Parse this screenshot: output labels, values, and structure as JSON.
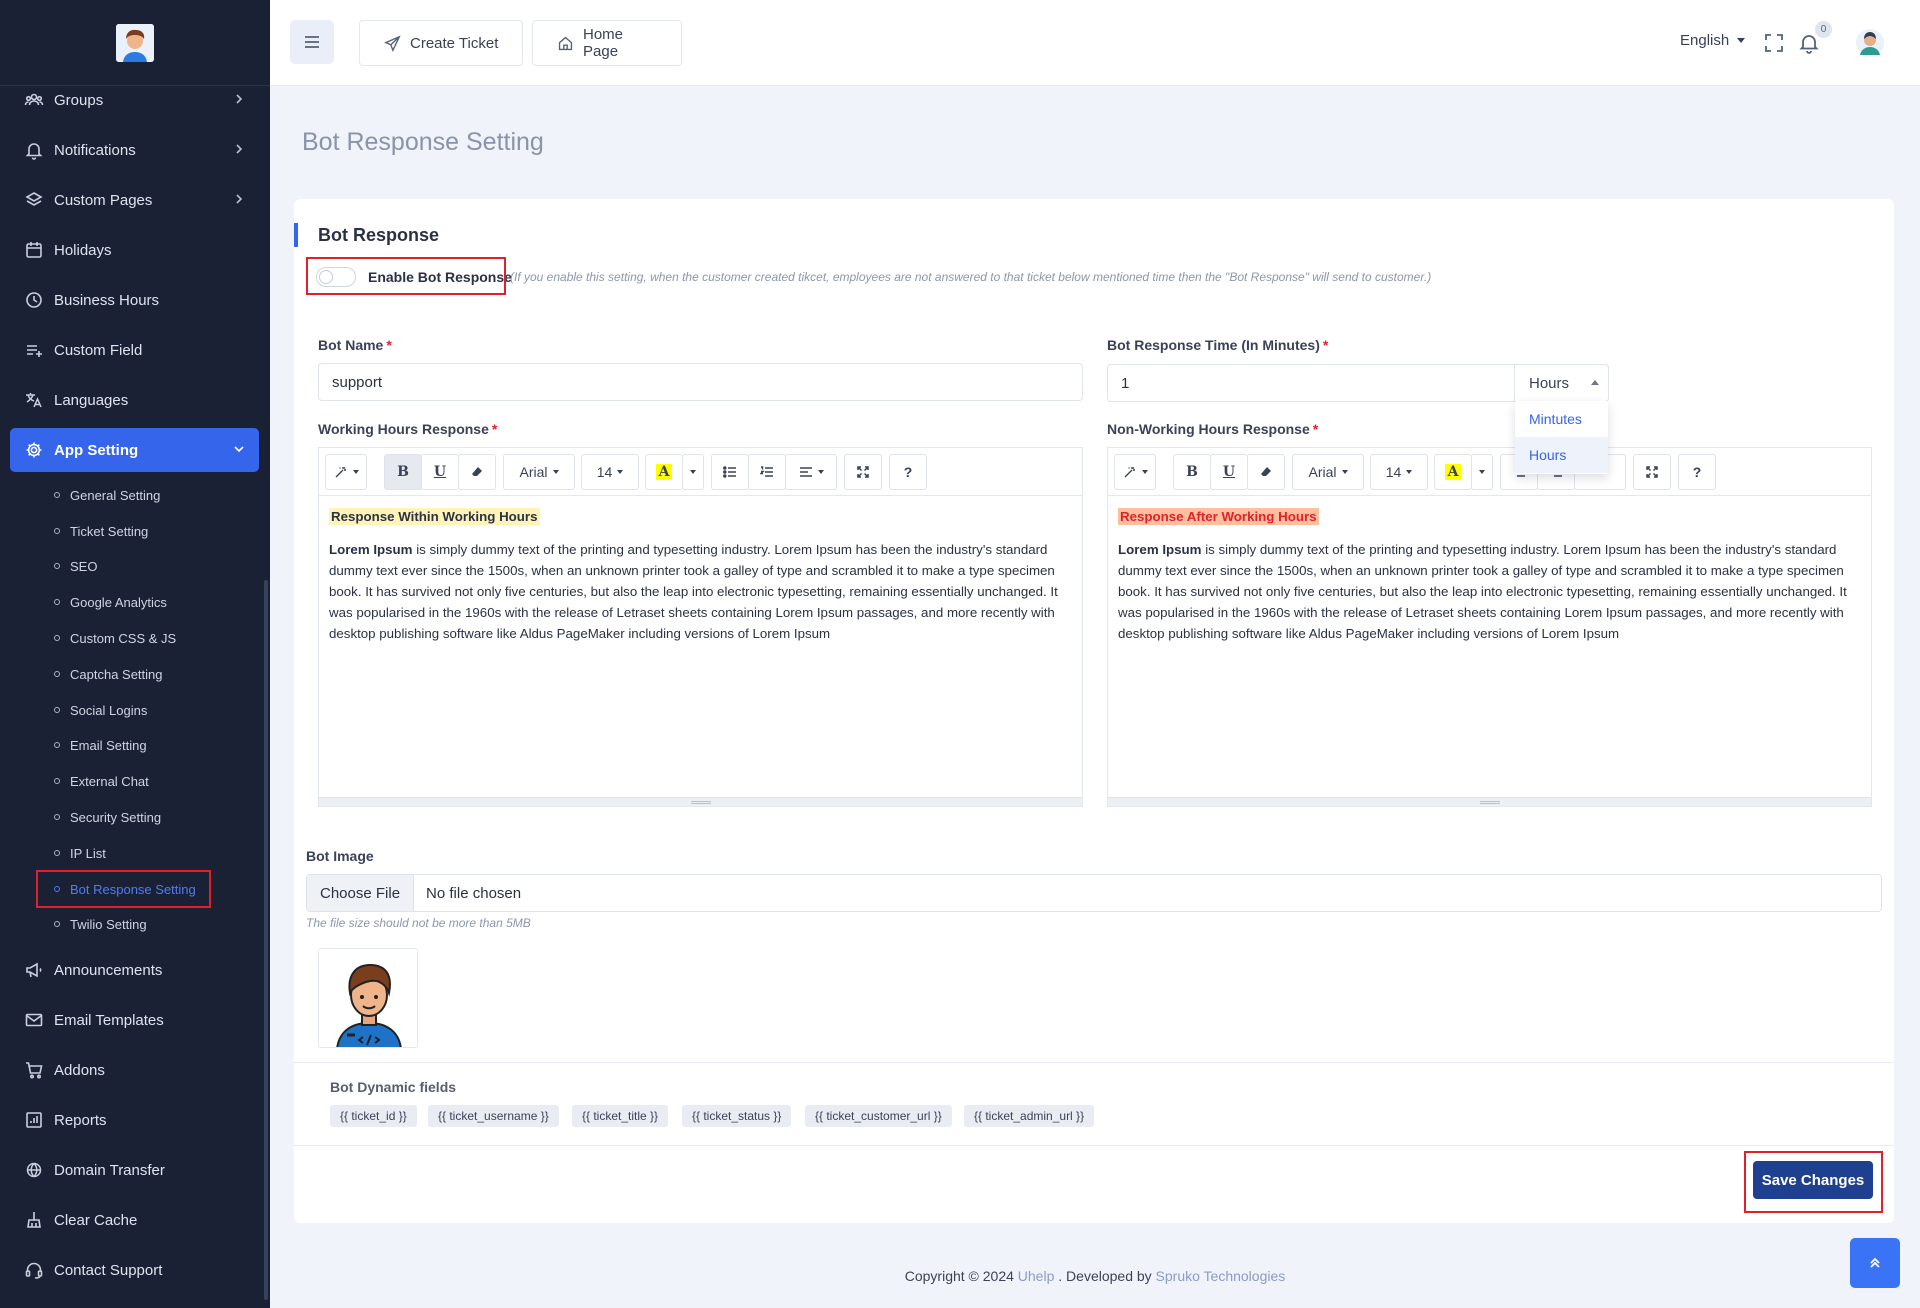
{
  "sidebar": {
    "menu": [
      {
        "label": "Groups",
        "icon": "groups-icon"
      },
      {
        "label": "Notifications",
        "icon": "bell-icon"
      },
      {
        "label": "Custom Pages",
        "icon": "layers-icon"
      },
      {
        "label": "Holidays",
        "icon": "calendar-icon"
      },
      {
        "label": "Business Hours",
        "icon": "clock-icon"
      },
      {
        "label": "Custom Field",
        "icon": "list-plus-icon"
      },
      {
        "label": "Languages",
        "icon": "translate-icon"
      },
      {
        "label": "App Setting",
        "icon": "gear-icon"
      },
      {
        "label": "Announcements",
        "icon": "megaphone-icon"
      },
      {
        "label": "Email Templates",
        "icon": "mail-icon"
      },
      {
        "label": "Addons",
        "icon": "cart-icon"
      },
      {
        "label": "Reports",
        "icon": "report-icon"
      },
      {
        "label": "Domain Transfer",
        "icon": "globe-icon"
      },
      {
        "label": "Clear Cache",
        "icon": "broom-icon"
      },
      {
        "label": "Contact Support",
        "icon": "headset-icon"
      }
    ],
    "sub_menu": [
      "General Setting",
      "Ticket Setting",
      "SEO",
      "Google Analytics",
      "Custom CSS & JS",
      "Captcha Setting",
      "Social Logins",
      "Email Setting",
      "External Chat",
      "Security Setting",
      "IP List",
      "Bot Response Setting",
      "Twilio Setting"
    ]
  },
  "header": {
    "create_ticket": "Create Ticket",
    "home_page": "Home Page",
    "language": "English",
    "notification_count": "0"
  },
  "page": {
    "title": "Bot Response Setting"
  },
  "bot_response": {
    "section_title": "Bot Response",
    "enable_label": "Enable Bot Response",
    "enable_hint": "(If you enable this setting, when the customer created tikcet, employees are not answered to that ticket below mentioned time then the \"Bot Response\" will send to customer.)",
    "bot_name_label": "Bot Name",
    "bot_name_value": "support",
    "response_time_label": "Bot Response Time (In Minutes)",
    "response_time_value": "1",
    "unit_selected": "Hours",
    "unit_options": [
      "Mintutes",
      "Hours"
    ],
    "required_mark": "*",
    "working_label": "Working Hours Response",
    "non_working_label": "Non-Working Hours Response",
    "toolbar": {
      "font": "Arial",
      "size": "14",
      "help": "?"
    },
    "working_heading": "Response Within Working Hours",
    "non_working_heading": "Response After Working Hours",
    "lorem_bold": "Lorem Ipsum",
    "lorem_text": " is simply dummy text of the printing and typesetting industry. Lorem Ipsum has been the industry's standard dummy text ever since the 1500s, when an unknown printer took a galley of type and scrambled it to make a type specimen book. It has survived not only five centuries, but also the leap into electronic typesetting, remaining essentially unchanged. It was popularised in the 1960s with the release of Letraset sheets containing Lorem Ipsum passages, and more recently with desktop publishing software like Aldus PageMaker including versions of Lorem Ipsum",
    "bot_image_label": "Bot Image",
    "choose_file": "Choose File",
    "no_file": "No file chosen",
    "file_hint": "The file size should not be more than 5MB",
    "dynamic_title": "Bot Dynamic fields",
    "dynamic_fields": [
      "{{ ticket_id }}",
      "{{ ticket_username }}",
      "{{ ticket_title }}",
      "{{ ticket_status }}",
      "{{ ticket_customer_url }}",
      "{{ ticket_admin_url }}"
    ],
    "save_label": "Save Changes"
  },
  "footer": {
    "prefix": "Copyright © 2024 ",
    "brand": "Uhelp",
    "middle": " . Developed by ",
    "company": "Spruko Technologies"
  },
  "colors": {
    "sidebar_bg": "#1b2135",
    "accent": "#3565eb",
    "save_button": "#1f3f8f",
    "highlight_red": "#e0212c"
  }
}
